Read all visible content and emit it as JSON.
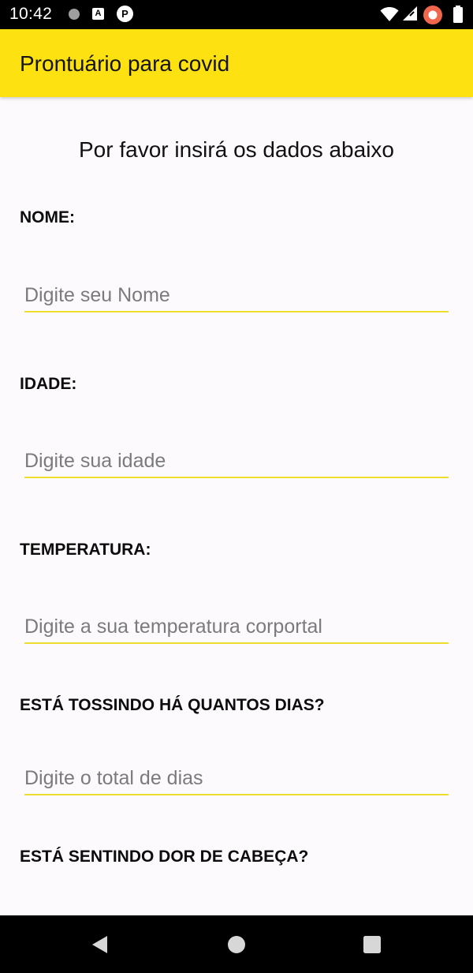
{
  "status_bar": {
    "time": "10:42",
    "icons": [
      "notification-dot-icon",
      "a-badge-icon",
      "p-badge-icon",
      "wifi-icon",
      "cellular-signal-icon",
      "battery-saver-icon",
      "battery-icon"
    ]
  },
  "app_bar": {
    "title": "Prontuário para covid",
    "background": "#fde111"
  },
  "form": {
    "instruction": "Por favor insirá os dados abaixo",
    "fields": [
      {
        "label": "NOME:",
        "placeholder": "Digite seu Nome",
        "value": ""
      },
      {
        "label": "IDADE:",
        "placeholder": "Digite sua idade",
        "value": ""
      },
      {
        "label": "TEMPERATURA:",
        "placeholder": "Digite a sua temperatura corportal",
        "value": ""
      },
      {
        "label": "ESTÁ TOSSINDO HÁ QUANTOS DIAS?",
        "placeholder": "Digite o total de dias",
        "value": ""
      },
      {
        "label": "ESTÁ SENTINDO DOR DE CABEÇA?"
      }
    ],
    "underline_color": "#f0de2e"
  },
  "nav_bar": {
    "buttons": [
      "back-icon",
      "home-icon",
      "recents-icon"
    ]
  }
}
